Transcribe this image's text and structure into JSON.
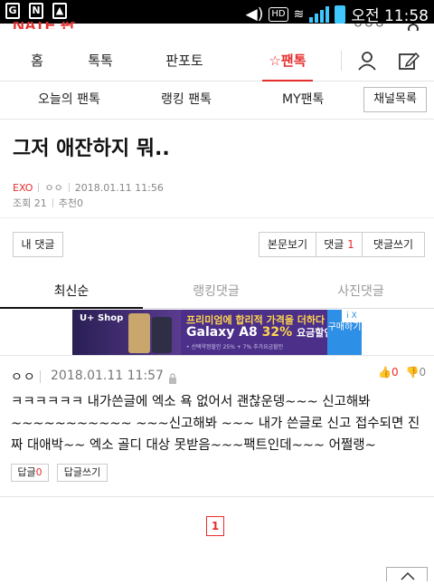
{
  "status_bar": {
    "time": "오전 11:58",
    "hd": "HD"
  },
  "site": {
    "logo": "NATE 판",
    "header_right_text": "ㅇㅇㅇ"
  },
  "main_nav": [
    {
      "label": "홈"
    },
    {
      "label": "톡톡"
    },
    {
      "label": "판포토"
    },
    {
      "label": "팬톡",
      "active": true
    }
  ],
  "sub_nav": [
    {
      "label": "오늘의 팬톡"
    },
    {
      "label": "랭킹 팬톡"
    },
    {
      "label": "MY팬톡"
    }
  ],
  "channel_list_button": "채널목록",
  "post": {
    "title": "그저 애잔하지 뭐..",
    "category": "EXO",
    "author": "ㅇㅇ",
    "datetime": "2018.01.11 11:56",
    "views_label": "조회",
    "views": "21",
    "recommend_label": "추천",
    "recommend": "0"
  },
  "buttons": {
    "my_comments": "내 댓글",
    "view_body": "본문보기",
    "comments_label": "댓글",
    "comments_count": "1",
    "write_comment": "댓글쓰기"
  },
  "comment_tabs": [
    {
      "label": "최신순",
      "active": true
    },
    {
      "label": "랭킹댓글"
    },
    {
      "label": "사진댓글"
    }
  ],
  "ad": {
    "brand": "U+ Shop",
    "headline": "프리미엄에 합리적 가격을 더하다",
    "product": "Galaxy A8",
    "discount": "32%",
    "discount_suffix": "요금할인",
    "fine_print": "• 선택약정할인 25% + 7% 추가요금할인",
    "cta": "구매하기",
    "ad_mark": "i X"
  },
  "comment": {
    "author": "ㅇㅇ",
    "datetime": "2018.01.11 11:57",
    "upvotes": "0",
    "downvotes": "0",
    "body": "ㅋㅋㅋㅋㅋㅋ 내가쓴글에 엑소 욕 없어서 괜찮운뎅~~~ 신고해봐~~~~~~~~~~~ ~~~신고해봐 ~~~ 내가 쓴글로 신고 접수되면 진짜 대애박~~ 엑소 골디 대상 못받음~~~팩트인데~~~ 어쩔랭~",
    "reply_label": "답글",
    "reply_count": "0",
    "write_reply": "답글쓰기"
  },
  "pagination": {
    "current": "1"
  }
}
